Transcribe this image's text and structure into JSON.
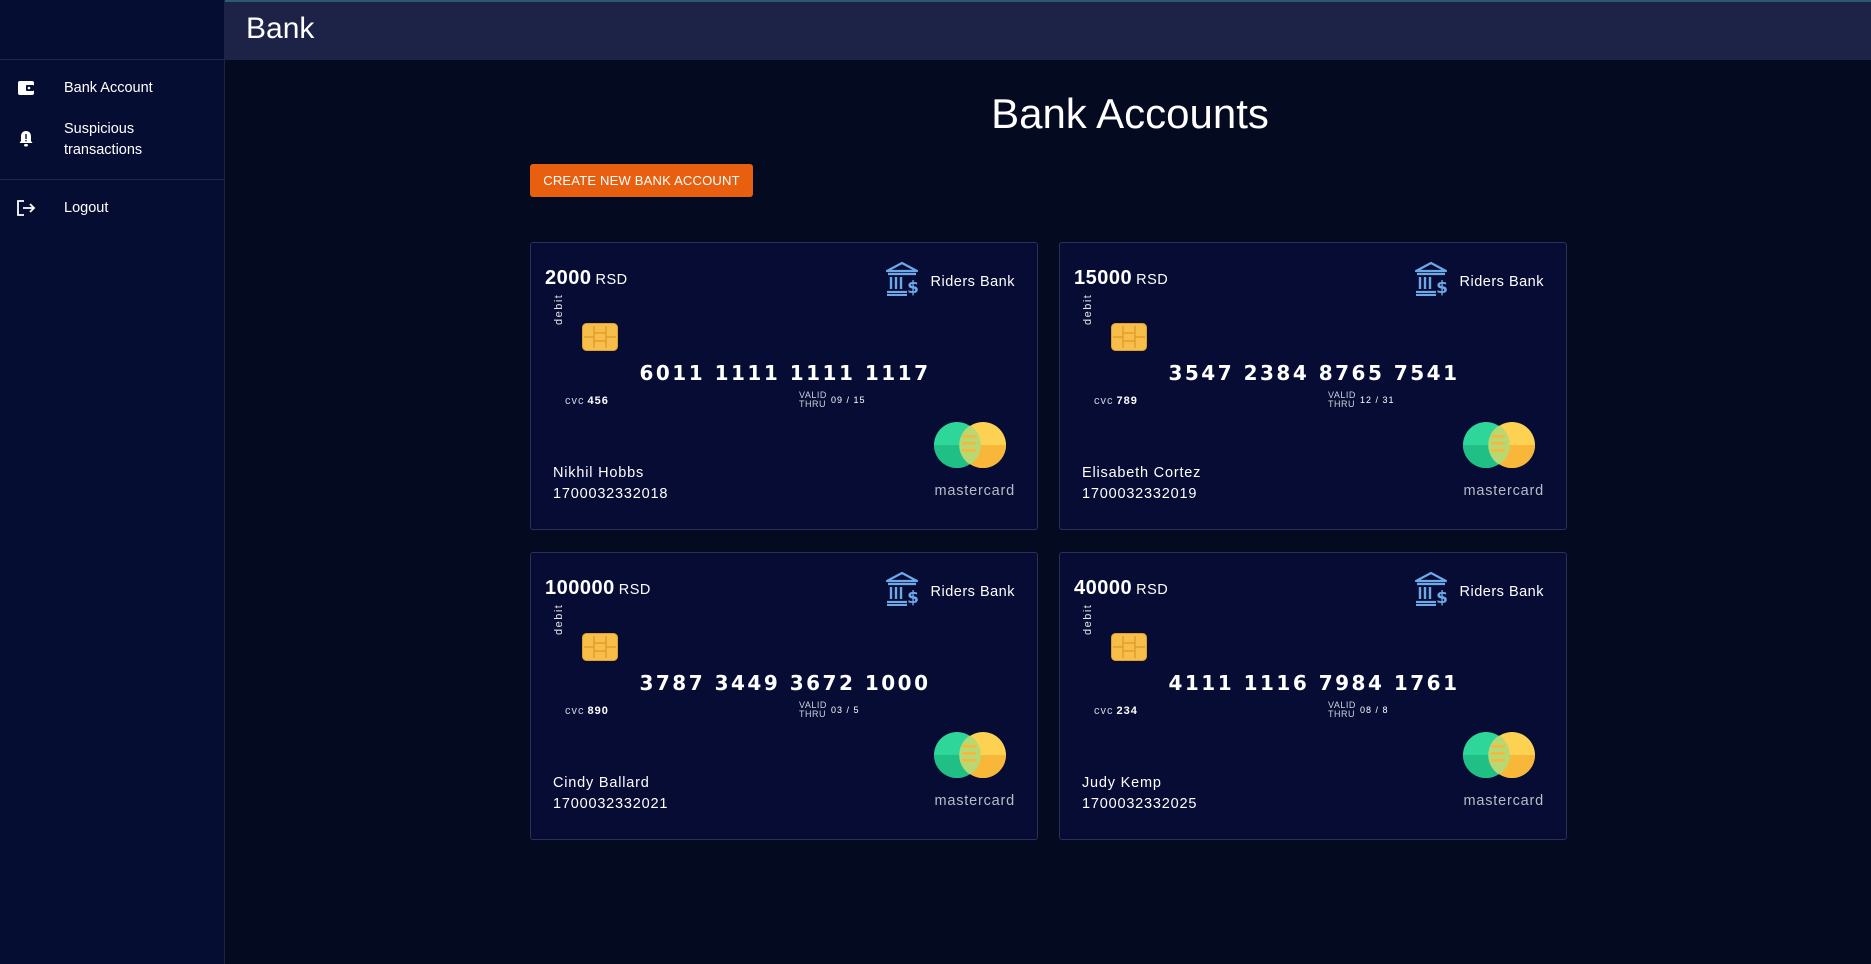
{
  "app": {
    "title": "Bank"
  },
  "sidebar": {
    "items": [
      {
        "label": "Bank Account",
        "icon": "wallet-icon"
      },
      {
        "label": "Suspicious transactions",
        "icon": "bell-alert-icon"
      }
    ],
    "logout": {
      "label": "Logout",
      "icon": "logout-icon"
    }
  },
  "main": {
    "title": "Bank Accounts",
    "create_button": "CREATE NEW BANK ACCOUNT"
  },
  "labels": {
    "card_type": "debit",
    "cvc": "cvc",
    "valid_thru_1": "VALID",
    "valid_thru_2": "THRU",
    "network": "mastercard"
  },
  "colors": {
    "accent": "#e8600f",
    "card_bg": "#060c34",
    "bank_icon": "#6fa8e8"
  },
  "cards": [
    {
      "amount": "2000",
      "currency": "RSD",
      "bank": "Riders Bank",
      "number": "6011 1111 1111 1117",
      "cvc": "456",
      "valid": "09 / 15",
      "holder": "Nikhil Hobbs",
      "account": "1700032332018"
    },
    {
      "amount": "15000",
      "currency": "RSD",
      "bank": "Riders Bank",
      "number": "3547 2384 8765 7541",
      "cvc": "789",
      "valid": "12 / 31",
      "holder": "Elisabeth Cortez",
      "account": "1700032332019"
    },
    {
      "amount": "100000",
      "currency": "RSD",
      "bank": "Riders Bank",
      "number": "3787 3449 3672 1000",
      "cvc": "890",
      "valid": "03 / 5",
      "holder": "Cindy Ballard",
      "account": "1700032332021"
    },
    {
      "amount": "40000",
      "currency": "RSD",
      "bank": "Riders Bank",
      "number": "4111 1116 7984 1761",
      "cvc": "234",
      "valid": "08 / 8",
      "holder": "Judy Kemp",
      "account": "1700032332025"
    }
  ]
}
